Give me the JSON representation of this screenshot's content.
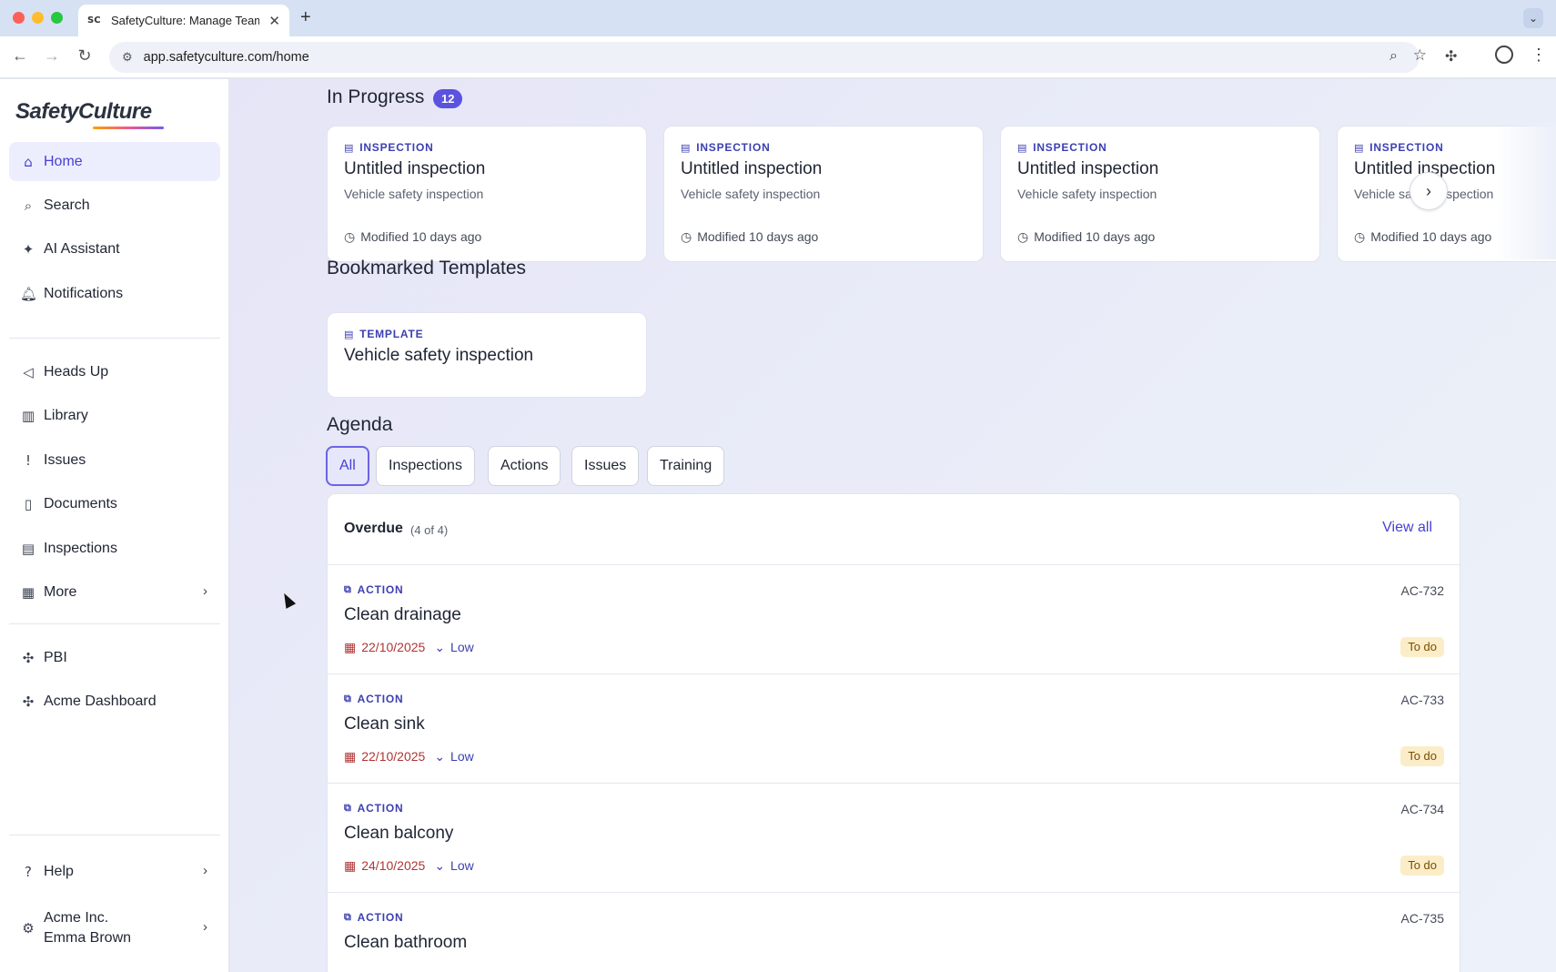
{
  "browser": {
    "tab_title": "SafetyCulture: Manage Teams",
    "tab_favicon": "SC",
    "url": "app.safetyculture.com/home"
  },
  "sidebar": {
    "logo": "SafetyCulture",
    "items": [
      {
        "label": "Home",
        "icon": "home-icon",
        "glyph": "⌂"
      },
      {
        "label": "Search",
        "icon": "search-icon",
        "glyph": "⌕"
      },
      {
        "label": "AI Assistant",
        "icon": "sparkle-icon",
        "glyph": "✦"
      },
      {
        "label": "Notifications",
        "icon": "bell-icon",
        "glyph": "♫"
      },
      {
        "label": "Heads Up",
        "icon": "megaphone-icon",
        "glyph": "◁"
      },
      {
        "label": "Library",
        "icon": "library-icon",
        "glyph": "▥"
      },
      {
        "label": "Issues",
        "icon": "issue-icon",
        "glyph": "!"
      },
      {
        "label": "Documents",
        "icon": "document-icon",
        "glyph": "▯"
      },
      {
        "label": "Inspections",
        "icon": "clipboard-icon",
        "glyph": "▤"
      },
      {
        "label": "More",
        "icon": "grid-icon",
        "glyph": "▦"
      },
      {
        "label": "PBI",
        "icon": "puzzle-icon",
        "glyph": "✣"
      },
      {
        "label": "Acme Dashboard",
        "icon": "puzzle-icon",
        "glyph": "✣"
      },
      {
        "label": "Help",
        "icon": "help-icon",
        "glyph": "?"
      }
    ],
    "account": {
      "org": "Acme Inc.",
      "user": "Emma Brown"
    }
  },
  "in_progress": {
    "title": "In Progress",
    "count": "12",
    "cards": [
      {
        "type": "INSPECTION",
        "title": "Untitled inspection",
        "subtitle": "Vehicle safety inspection",
        "modified": "Modified 10 days ago"
      },
      {
        "type": "INSPECTION",
        "title": "Untitled inspection",
        "subtitle": "Vehicle safety inspection",
        "modified": "Modified 10 days ago"
      },
      {
        "type": "INSPECTION",
        "title": "Untitled inspection",
        "subtitle": "Vehicle safety inspection",
        "modified": "Modified 10 days ago"
      },
      {
        "type": "INSPECTION",
        "title": "Untitled inspection",
        "subtitle": "Vehicle safety inspection",
        "modified": "Modified 10 days ago"
      }
    ]
  },
  "bookmarked": {
    "title": "Bookmarked Templates",
    "cards": [
      {
        "type": "TEMPLATE",
        "title": "Vehicle safety inspection"
      }
    ]
  },
  "agenda": {
    "title": "Agenda",
    "filters": [
      "All",
      "Inspections",
      "Actions",
      "Issues",
      "Training"
    ],
    "active_filter": "All",
    "overdue": {
      "title": "Overdue",
      "count": "(4 of 4)",
      "view_all": "View all",
      "items": [
        {
          "type": "ACTION",
          "title": "Clean drainage",
          "date": "22/10/2025",
          "priority": "Low",
          "id": "AC-732",
          "status": "To do"
        },
        {
          "type": "ACTION",
          "title": "Clean sink",
          "date": "22/10/2025",
          "priority": "Low",
          "id": "AC-733",
          "status": "To do"
        },
        {
          "type": "ACTION",
          "title": "Clean balcony",
          "date": "24/10/2025",
          "priority": "Low",
          "id": "AC-734",
          "status": "To do"
        },
        {
          "type": "ACTION",
          "title": "Clean bathroom",
          "date": "",
          "priority": "",
          "id": "AC-735",
          "status": ""
        }
      ]
    }
  },
  "colors": {
    "accent": "#4740d4",
    "pill": "#5b52e0",
    "overdue_date": "#b03434",
    "status_bg": "#fbedc8"
  }
}
